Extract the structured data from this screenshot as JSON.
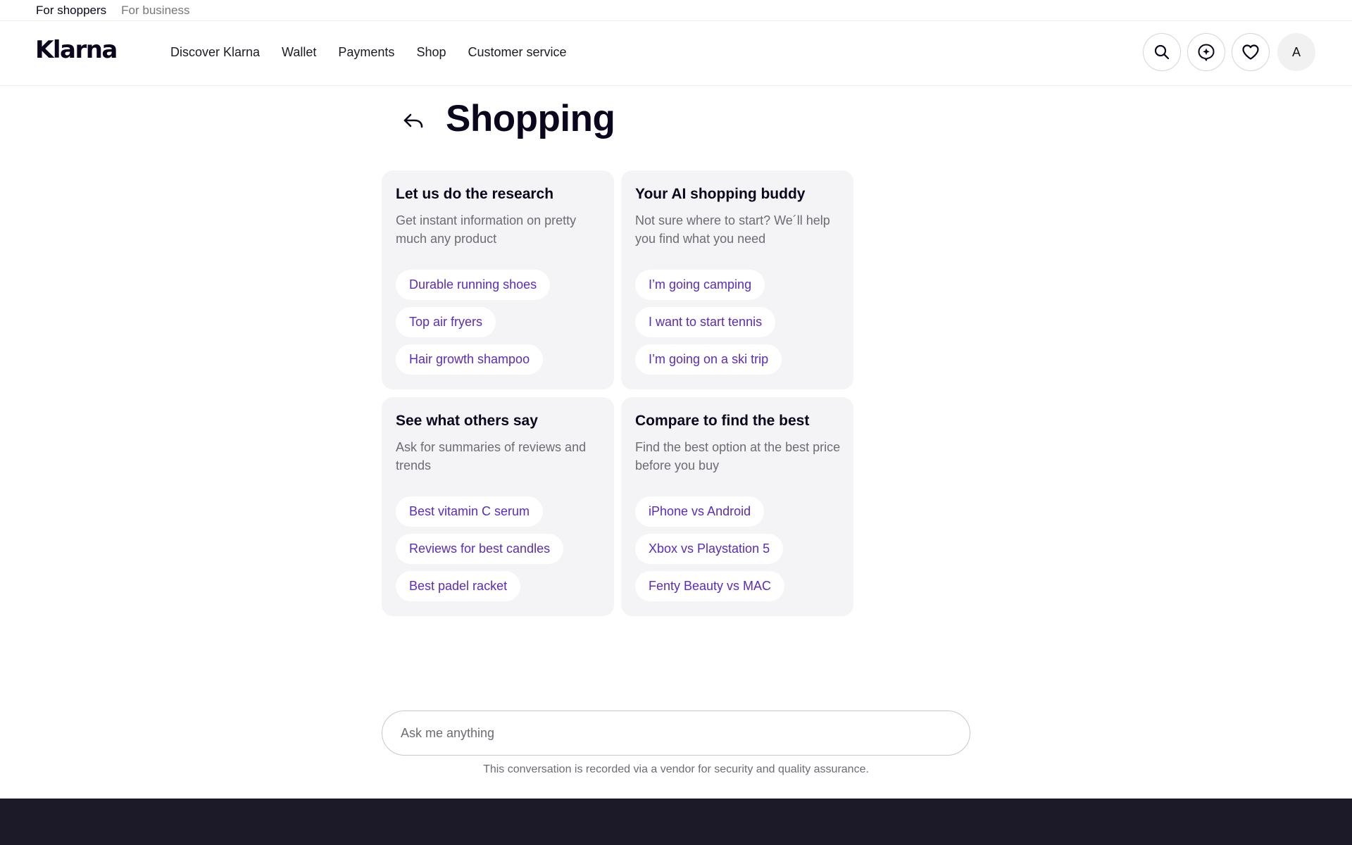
{
  "topbar": {
    "for_shoppers": "For shoppers",
    "for_business": "For business"
  },
  "header": {
    "logo": "Klarna",
    "nav": [
      "Discover Klarna",
      "Wallet",
      "Payments",
      "Shop",
      "Customer service"
    ],
    "avatar_initial": "A"
  },
  "page": {
    "title": "Shopping"
  },
  "cards": [
    {
      "title": "Let us do the research",
      "description": "Get instant information on pretty much any product",
      "chips": [
        "Durable running shoes",
        "Top air fryers",
        "Hair growth shampoo"
      ]
    },
    {
      "title": "Your AI shopping buddy",
      "description": "Not sure where to start? We´ll help you find what you need",
      "chips": [
        "I’m going camping",
        "I want to start tennis",
        "I’m going on a ski trip"
      ]
    },
    {
      "title": "See what others say",
      "description": "Ask for summaries of reviews and trends",
      "chips": [
        "Best vitamin C serum",
        "Reviews for best candles",
        "Best padel racket"
      ]
    },
    {
      "title": "Compare to find the best",
      "description": "Find the best option at the best price before you buy",
      "chips": [
        "iPhone vs Android",
        "Xbox vs Playstation 5",
        "Fenty Beauty vs MAC"
      ]
    }
  ],
  "chat": {
    "placeholder": "Ask me anything",
    "disclaimer": "This conversation is recorded via a vendor for security and quality assurance."
  },
  "colors": {
    "chip_text": "#5a2bbd",
    "card_bg": "#f4f4f6",
    "footer_bg": "#1c1a28"
  },
  "icons": [
    "search-icon",
    "ai-assistant-icon",
    "heart-icon",
    "back-arrow-icon"
  ]
}
